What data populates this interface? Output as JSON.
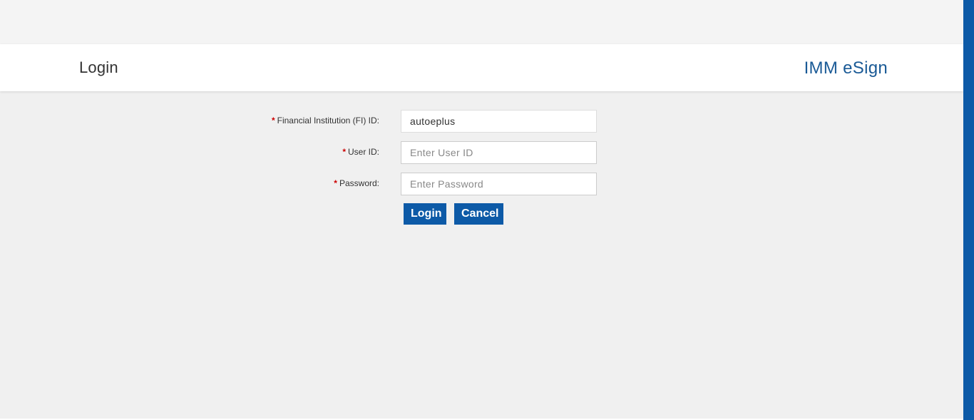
{
  "header": {
    "title": "Login",
    "brand": "IMM eSign"
  },
  "form": {
    "required_marker": "*",
    "fi_id": {
      "label": "Financial Institution (FI) ID:",
      "value": "autoeplus",
      "placeholder": ""
    },
    "user_id": {
      "label": "User ID:",
      "value": "",
      "placeholder": "Enter User ID"
    },
    "password": {
      "label": "Password:",
      "value": "",
      "placeholder": "Enter Password"
    },
    "login_label": "Login",
    "cancel_label": "Cancel"
  },
  "colors": {
    "accent": "#0d5aa7",
    "brand_text": "#1a5a96",
    "required": "#cc0000",
    "background": "#f0f0f0"
  }
}
